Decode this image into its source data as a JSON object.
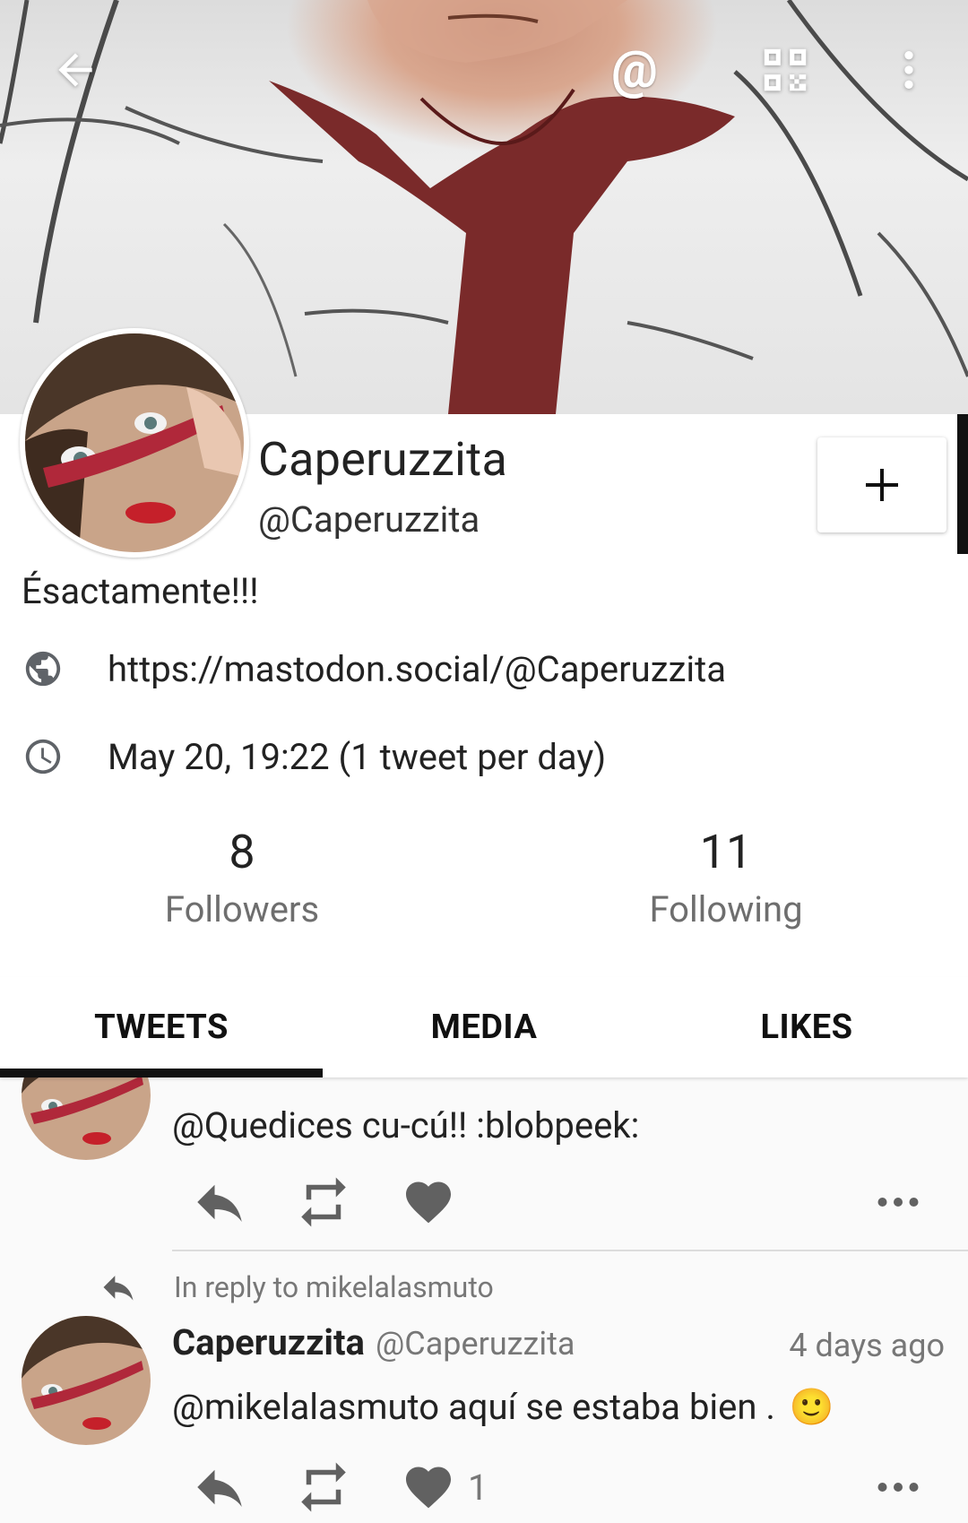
{
  "toolbar": {
    "back_icon": "arrow-left-icon",
    "mention_label": "@",
    "qr_icon": "qr-code-icon",
    "more_icon": "more-vert-icon"
  },
  "profile": {
    "display_name": "Caperuzzita",
    "handle": "@Caperuzzita",
    "follow_label": "+",
    "bio": "Ésactamente!!!",
    "url": "https://mastodon.social/@Caperuzzita",
    "joined": "May 20, 19:22 (1 tweet per day)",
    "followers_count": "8",
    "followers_label": "Followers",
    "following_count": "11",
    "following_label": "Following"
  },
  "tabs": [
    {
      "label": "TWEETS",
      "active": true
    },
    {
      "label": "MEDIA",
      "active": false
    },
    {
      "label": "LIKES",
      "active": false
    }
  ],
  "feed": {
    "items": [
      {
        "text": "@Quedices cu-cú!! :blobpeek:"
      },
      {
        "reply_to": "In reply to mikelalasmuto",
        "name": "Caperuzzita",
        "handle": "@Caperuzzita",
        "time": "4 days ago",
        "text": "@mikelalasmuto aquí se estaba bien .",
        "emoji": "🙂",
        "like_count": "1"
      }
    ]
  },
  "colors": {
    "accent": "#111111",
    "icon_gray": "#5f6368",
    "action_gray": "#616161",
    "text": "#222222",
    "muted": "#777777"
  }
}
